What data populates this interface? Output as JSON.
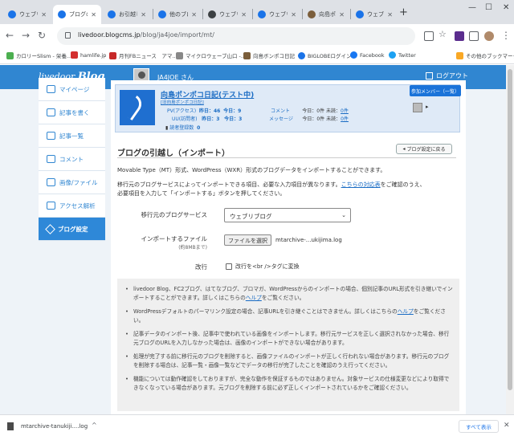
{
  "browser": {
    "tabs": [
      {
        "label": "ウェブリブロ",
        "icon_color": "#1a73e8"
      },
      {
        "label": "ブログの引",
        "icon_color": "#1a73e8",
        "active": true
      },
      {
        "label": "お引越しし",
        "icon_color": "#1a73e8"
      },
      {
        "label": "他のブログ",
        "icon_color": "#1a73e8"
      },
      {
        "label": "ウェブリブロ",
        "icon_color": "#3c4043"
      },
      {
        "label": "ウェブリブロ",
        "icon_color": "#1a73e8"
      },
      {
        "label": "向島ポンポ",
        "icon_color": "#7b5e3b"
      },
      {
        "label": "ウェブリブロ",
        "icon_color": "#1a73e8"
      }
    ],
    "url_host": "livedoor.blogcms.jp",
    "url_path": "/blog/ja4joe/import/mt/",
    "bookmarks": [
      {
        "label": "カロリーSlism - 栄養...",
        "icon_color": "#4caf50"
      },
      {
        "label": "hamlife.jp",
        "icon_color": "#d32f2f"
      },
      {
        "label": "月刊FBニュース　アマ...",
        "icon_color": "#c62828"
      },
      {
        "label": "マイクロウェーブ山口 -...",
        "icon_color": "#888888"
      },
      {
        "label": "向島ボンポコ日記",
        "icon_color": "#7b5e3b"
      },
      {
        "label": "BIGLOBEログイン",
        "icon_color": "#1a73e8"
      },
      {
        "label": "Facebook",
        "icon_color": "#1877f2"
      },
      {
        "label": "Twitter",
        "icon_color": "#1da1f2"
      },
      {
        "label": "その他のブックマーク",
        "icon_color": "#f9a825"
      }
    ]
  },
  "header": {
    "logo_main": "livedoor",
    "logo_blog": "Blog",
    "username": "JA4JOE さん",
    "logout": "ログアウト"
  },
  "sidebar": {
    "items": [
      {
        "label": "マイページ"
      },
      {
        "label": "記事を書く"
      },
      {
        "label": "記事一覧"
      },
      {
        "label": "コメント"
      },
      {
        "label": "画像/ファイル"
      },
      {
        "label": "アクセス解析"
      },
      {
        "label": "ブログ設定",
        "active": true
      }
    ]
  },
  "blog": {
    "title": "向島ポンポコ日記(テスト中)",
    "subtitle": "[旧向島ポンポコ日記]",
    "member_button": "参加メンバー（一覧）",
    "pv_label": "PV(アクセス)",
    "pv_yesterday": "昨日：46",
    "pv_today": "今日：9",
    "uu_label": "UU(訪問者)",
    "uu_yesterday": "昨日：3",
    "uu_today": "今日：3",
    "reader_label": "読者登録数",
    "reader_count": "0",
    "comment_label": "コメント",
    "comment_today": "今日：0件",
    "comment_unread": "未読：",
    "comment_unread_count": "0件",
    "message_label": "メッセージ",
    "message_today": "今日：0件",
    "message_unread": "未読：",
    "message_unread_count": "0件"
  },
  "content": {
    "section_title": "ブログの引越し（インポート）",
    "back_button": "ブログ設定に戻る",
    "intro": "Movable Type（MT）形式、WordPress（WXR）形式のブログデータをインポートすることができます。",
    "intro2_line1_pre": "移行元のブログサービスによってインポートできる項目、必要な入力項目が異なります。",
    "intro2_link": "こちらの対応表",
    "intro2_line1_post": "をご確認のうえ、",
    "intro2_line2": "必要項目を入力して「インポートする」ボタンを押してください。",
    "service_label": "移行元のブログサービス",
    "service_value": "ウェブリブログ",
    "file_label": "インポートするファイル",
    "file_note": "(約8MBまで)",
    "file_button": "ファイルを選択",
    "file_name": "mtarchive-...ukijima.log",
    "newline_label": "改行",
    "newline_option": "改行を<br />タグに変換",
    "notes": [
      {
        "pre": "livedoor Blog、FC2ブログ、はてなブログ、ブロマガ、WordPressからのインポートの場合、個別記事のURL形式を引き継いでインポートすることができます。詳しくはこちらの",
        "link": "ヘルプ",
        "post": "をご覧ください。"
      },
      {
        "pre": "WordPressデフォルトのパーマリンク設定の場合、記事URLを引き継ぐことはできません。詳しくはこちらの",
        "link": "ヘルプ",
        "post": "をご覧ください。"
      },
      {
        "pre": "記事データのインポート後、記事中で使われている画像をインポートします。移行元サービスを正しく選択されなかった場合、移行元ブログのURLを入力しなかった場合は、画像のインポートができない場合があります。",
        "link": "",
        "post": ""
      },
      {
        "pre": "処理が完了する前に移行元のブログを削除すると、画像ファイルのインポートが正しく行われない場合があります。移行元のブログを削除する場合は、記事一覧・画像一覧などでデータの移行が完了したことを確認のうえ行ってください。",
        "link": "",
        "post": ""
      },
      {
        "pre": "機能については動作確認をしておりますが、完全な動作を保証するものではありません。対象サービスの仕様変更などにより取得できなくなっている場合があります。元ブログを削除する前に必ず正しくインポートされているかをご確認ください。",
        "link": "",
        "post": ""
      }
    ]
  },
  "download": {
    "file": "mtarchive-tanukiji....log",
    "show_all": "すべて表示"
  }
}
